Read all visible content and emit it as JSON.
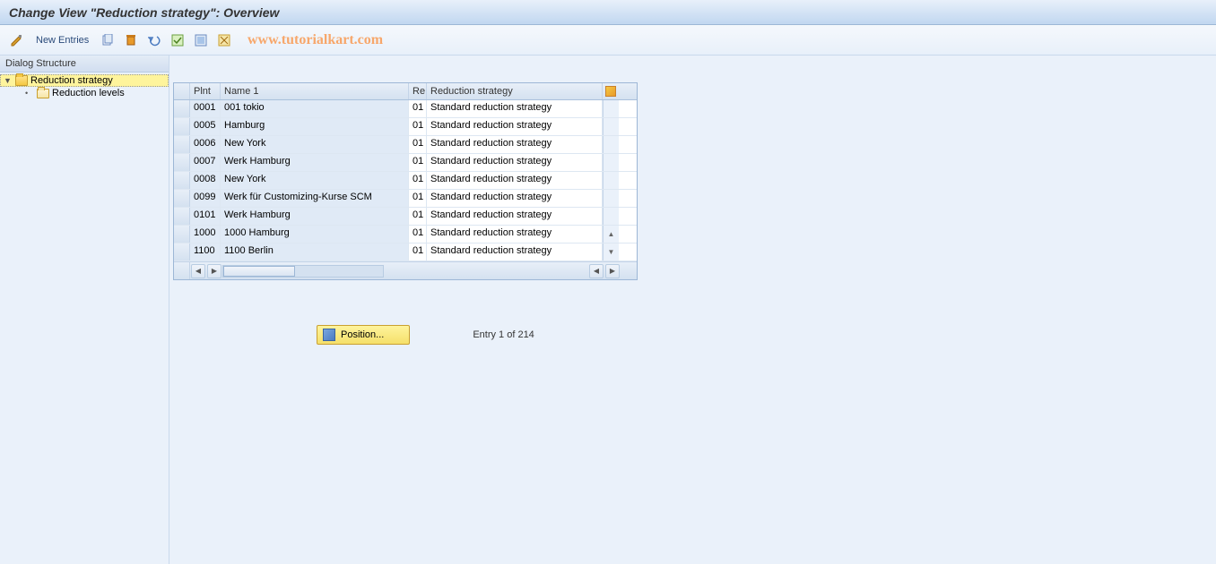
{
  "title": "Change View \"Reduction strategy\": Overview",
  "toolbar": {
    "new_entries": "New Entries"
  },
  "watermark": "www.tutorialkart.com",
  "sidebar": {
    "header": "Dialog Structure",
    "nodes": [
      {
        "label": "Reduction strategy",
        "selected": true,
        "open": true
      },
      {
        "label": "Reduction levels",
        "selected": false,
        "open": false
      }
    ]
  },
  "grid": {
    "columns": {
      "plnt": "Plnt",
      "name": "Name 1",
      "re": "Re",
      "strategy": "Reduction strategy"
    },
    "rows": [
      {
        "plnt": "0001",
        "name": "001 tokio",
        "re": "01",
        "strategy": "Standard reduction strategy"
      },
      {
        "plnt": "0005",
        "name": "Hamburg",
        "re": "01",
        "strategy": "Standard reduction strategy"
      },
      {
        "plnt": "0006",
        "name": "New York",
        "re": "01",
        "strategy": "Standard reduction strategy"
      },
      {
        "plnt": "0007",
        "name": "Werk Hamburg",
        "re": "01",
        "strategy": "Standard reduction strategy"
      },
      {
        "plnt": "0008",
        "name": "New York",
        "re": "01",
        "strategy": "Standard reduction strategy"
      },
      {
        "plnt": "0099",
        "name": "Werk für Customizing-Kurse SCM",
        "re": "01",
        "strategy": "Standard reduction strategy"
      },
      {
        "plnt": "0101",
        "name": "Werk Hamburg",
        "re": "01",
        "strategy": "Standard reduction strategy"
      },
      {
        "plnt": "1000",
        "name": "1000 Hamburg",
        "re": "01",
        "strategy": "Standard reduction strategy"
      },
      {
        "plnt": "1100",
        "name": "1100 Berlin",
        "re": "01",
        "strategy": "Standard reduction strategy"
      }
    ]
  },
  "footer": {
    "position_label": "Position...",
    "entry_text": "Entry 1 of 214"
  }
}
